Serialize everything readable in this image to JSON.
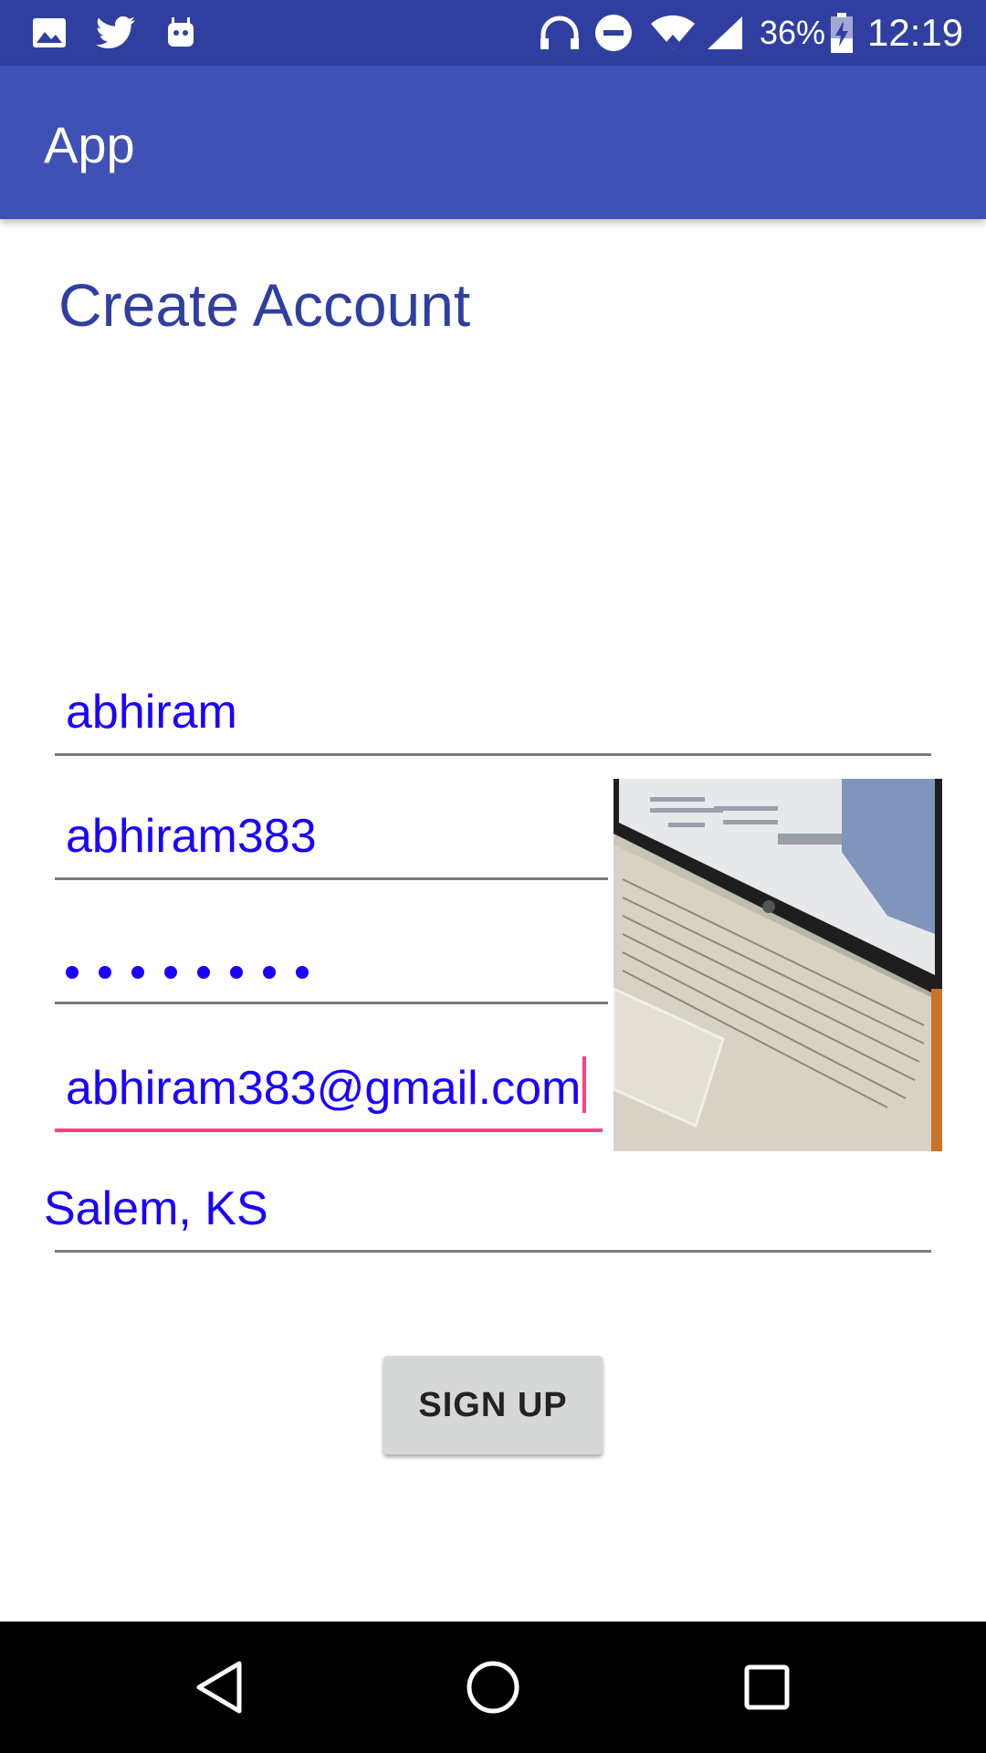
{
  "status_bar": {
    "battery_percent": "36%",
    "time": "12:19",
    "icons": [
      "image-icon",
      "twitter-icon",
      "android-icon",
      "headphones-icon",
      "do-not-disturb-icon",
      "wifi-icon",
      "cell-signal-icon",
      "battery-charging-icon"
    ]
  },
  "app_bar": {
    "title": "App"
  },
  "form": {
    "heading": "Create Account",
    "name_value": "abhiram",
    "username_value": "abhiram383",
    "password_length": 8,
    "email_value": "abhiram383@gmail.com",
    "location_value": "Salem, KS",
    "signup_label": "SIGN UP"
  },
  "photo": {
    "subject": "laptop photo"
  },
  "nav_bar": {
    "icons": [
      "back-icon",
      "home-icon",
      "recents-icon"
    ]
  },
  "colors": {
    "status_bar": "#303f9f",
    "app_bar": "#3f51b5",
    "heading": "#303f9f",
    "input_text": "#1a00ff",
    "accent": "#ff4081"
  }
}
